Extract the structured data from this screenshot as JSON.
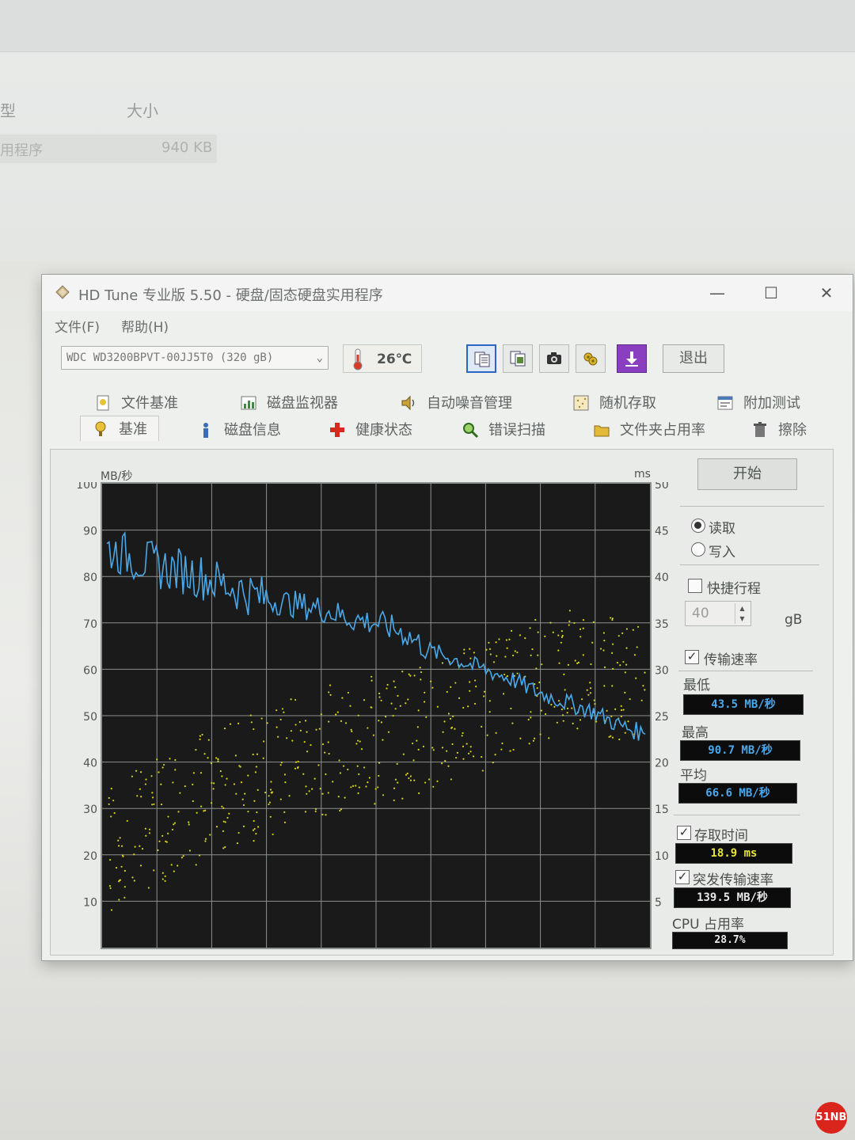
{
  "background_window": {
    "col_type": "型",
    "col_size": "大小",
    "row_type": "用程序",
    "row_size": "940 KB"
  },
  "window": {
    "title": "HD Tune 专业版 5.50 - 硬盘/固态硬盘实用程序",
    "minimize": "—",
    "maximize": "☐",
    "close": "✕"
  },
  "menu": {
    "file": "文件(F)",
    "help": "帮助(H)"
  },
  "toolbar": {
    "drive": "WDC WD3200BPVT-00JJ5T0 (320 gB)",
    "temperature": "26℃",
    "exit_label": "退出",
    "icons": [
      "copy-text-icon",
      "copy-screenshot-icon",
      "camera-icon",
      "options-icon",
      "save-download-icon"
    ]
  },
  "tabs_top": [
    {
      "label": "文件基准",
      "icon": "file-benchmark-icon"
    },
    {
      "label": "磁盘监视器",
      "icon": "disk-monitor-icon"
    },
    {
      "label": "自动噪音管理",
      "icon": "speaker-icon"
    },
    {
      "label": "随机存取",
      "icon": "random-access-icon"
    },
    {
      "label": "附加测试",
      "icon": "extra-tests-icon"
    }
  ],
  "tabs_bottom": [
    {
      "label": "基准",
      "icon": "benchmark-icon",
      "selected": true
    },
    {
      "label": "磁盘信息",
      "icon": "info-icon"
    },
    {
      "label": "健康状态",
      "icon": "health-icon"
    },
    {
      "label": "错误扫描",
      "icon": "error-scan-icon"
    },
    {
      "label": "文件夹占用率",
      "icon": "folder-icon"
    },
    {
      "label": "擦除",
      "icon": "erase-icon"
    }
  ],
  "controls": {
    "start_label": "开始",
    "read_label": "读取",
    "write_label": "写入",
    "read_selected": true,
    "short_stroke_label": "快捷行程",
    "short_stroke_checked": false,
    "short_stroke_value": "40",
    "short_stroke_unit": "gB",
    "transfer_rate_label": "传输速率",
    "transfer_rate_checked": true,
    "min_label": "最低",
    "min_value": "43.5 MB/秒",
    "max_label": "最高",
    "max_value": "90.7 MB/秒",
    "avg_label": "平均",
    "avg_value": "66.6 MB/秒",
    "access_time_label": "存取时间",
    "access_time_checked": true,
    "access_time_value": "18.9 ms",
    "burst_label": "突发传输速率",
    "burst_checked": true,
    "burst_value": "139.5 MB/秒",
    "cpu_label": "CPU 占用率",
    "cpu_value": "28.7%"
  },
  "chart_data": {
    "type": "line",
    "ylabel_left": "MB/秒",
    "ylabel_right": "ms",
    "y_left_ticks": [
      "100",
      "90",
      "80",
      "70",
      "60",
      "50",
      "40",
      "30",
      "20",
      "10"
    ],
    "y_right_ticks": [
      "50",
      "45",
      "40",
      "35",
      "30",
      "25",
      "20",
      "15",
      "10",
      "5"
    ],
    "y_left_range": [
      0,
      100
    ],
    "y_right_range": [
      0,
      50
    ],
    "grid": true,
    "series": [
      {
        "color": "#4aa8e8",
        "x": [
          0,
          5,
          10,
          15,
          20,
          25,
          30,
          35,
          40,
          45,
          50,
          55,
          60,
          65,
          70,
          75,
          80,
          85,
          90,
          95,
          100
        ],
        "values": [
          86,
          84,
          82,
          81,
          79,
          77,
          75,
          74,
          73,
          71,
          70,
          68,
          64,
          62,
          60,
          58,
          55,
          53,
          51,
          48,
          46
        ]
      },
      {
        "color": "#d8d21e",
        "x": [
          0,
          5,
          10,
          15,
          20,
          25,
          30,
          35,
          40,
          45,
          50,
          55,
          60,
          65,
          70,
          75,
          80,
          85,
          90,
          95,
          100
        ],
        "values": [
          20,
          24,
          28,
          30,
          34,
          36,
          38,
          40,
          42,
          44,
          45,
          46,
          48,
          50,
          52,
          56,
          58,
          60,
          62,
          58,
          55
        ]
      }
    ]
  },
  "watermark": "51NB"
}
